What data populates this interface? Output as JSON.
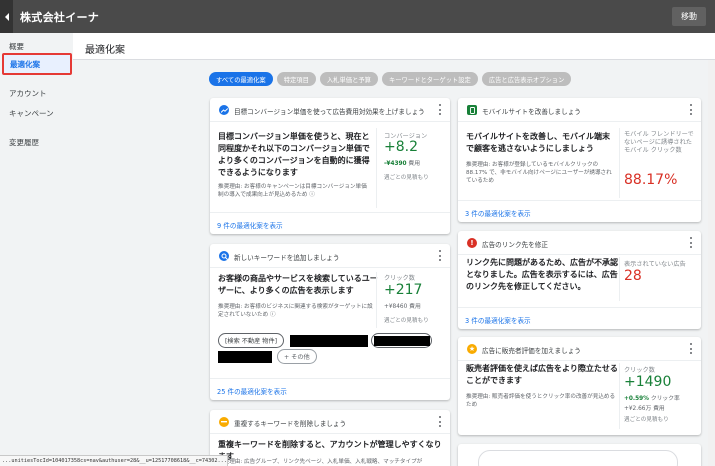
{
  "topbar": {
    "company": "株式会社イーナ",
    "move_label": "移動"
  },
  "sidebar": {
    "items": [
      "概要",
      "最適化案",
      "アカウント",
      "キャンペーン",
      "変更履歴"
    ]
  },
  "page": {
    "title": "最適化案"
  },
  "chips": [
    "すべての最適化案",
    "特定項目",
    "入札単価と予算",
    "キーワードとターゲット設定",
    "広告と広告表示オプション"
  ],
  "cards": {
    "cpa": {
      "title": "目標コンバージョン単価を使って広告費用対効果を上げましょう",
      "headline": "目標コンバージョン単価を使うと、現在と同程度かそれ以下のコンバージョン単価でより多くのコンバージョンを自動的に獲得できるようになります",
      "reason": "推奨理由: お客様のキャンペーンは目標コンバージョン単価制の導入で成果向上が見込めるため",
      "metric_label": "コンバージョン",
      "metric_value": "+8.2",
      "metric_sub_value": "-¥4390",
      "metric_sub_label": "費用",
      "metric_note": "週ごとの見積もり",
      "footer": "9 件の最適化案を表示"
    },
    "keywords": {
      "title": "新しいキーワードを追加しましょう",
      "headline": "お客様の商品やサービスを検索しているユーザーに、より多くの広告を表示します",
      "reason": "推奨理由: お客様のビジネスに関連する検索がターゲットに設定されていないため",
      "metric_label": "クリック数",
      "metric_value": "+217",
      "metric_sub_value": "+¥8460",
      "metric_sub_label": "費用",
      "metric_note": "週ごとの見積もり",
      "keyword_chip": "[検索 不動産 物件]",
      "more_chip": "+ その他",
      "footer": "25 件の最適化案を表示"
    },
    "duplicate": {
      "title": "重複するキーワードを削除しましょう",
      "headline": "重複キーワードを削除すると、アカウントが管理しやすくなります",
      "reason": "推奨理由: 広告グループ、リンク先ページ、入札単価、入札戦略、マッチタイプが"
    },
    "mobile": {
      "title": "モバイルサイトを改善しましょう",
      "headline": "モバイルサイトを改善し、モバイル端末で顧客を逃さないようにしましょう",
      "reason": "推奨理由: お客様が登録しているモバイルクリックの88.17% で、非モバイル向けページにユーザーが誘導されているため",
      "metric_label": "モバイル フレンドリーでないページに誘導されたモバイル クリック数",
      "metric_value": "88.17%",
      "footer": "3 件の最適化案を表示"
    },
    "link": {
      "title": "広告のリンク先を修正",
      "headline": "リンク先に問題があるため、広告が不承認となりました。広告を表示するには、広告のリンク先を修正してください。",
      "metric_label": "表示されていない広告",
      "metric_value": "28",
      "footer": "3 件の最適化案を表示"
    },
    "seller": {
      "title": "広告に販売者評価を加えましょう",
      "headline": "販売者評価を使えば広告をより際立たせることができます",
      "reason": "推奨理由: 販売者評価を使うとクリック率の改善が見込めるため",
      "metric_label": "クリック数",
      "metric_value": "+1490",
      "metric_pct": "+0.59%",
      "metric_pct_label": "クリック率",
      "metric_sub_value": "+¥2.66万",
      "metric_sub_label": "費用",
      "metric_note": "週ごとの見積もり"
    }
  },
  "status_url": "...unitiesTocId=104017358cs=nav&authuser=28&__u=12517708618&__c=74302...",
  "colors": {
    "accent": "#1a73e8",
    "positive": "#188038",
    "negative": "#d93025",
    "warning": "#f9ab00",
    "highlight_border": "#e53935"
  }
}
